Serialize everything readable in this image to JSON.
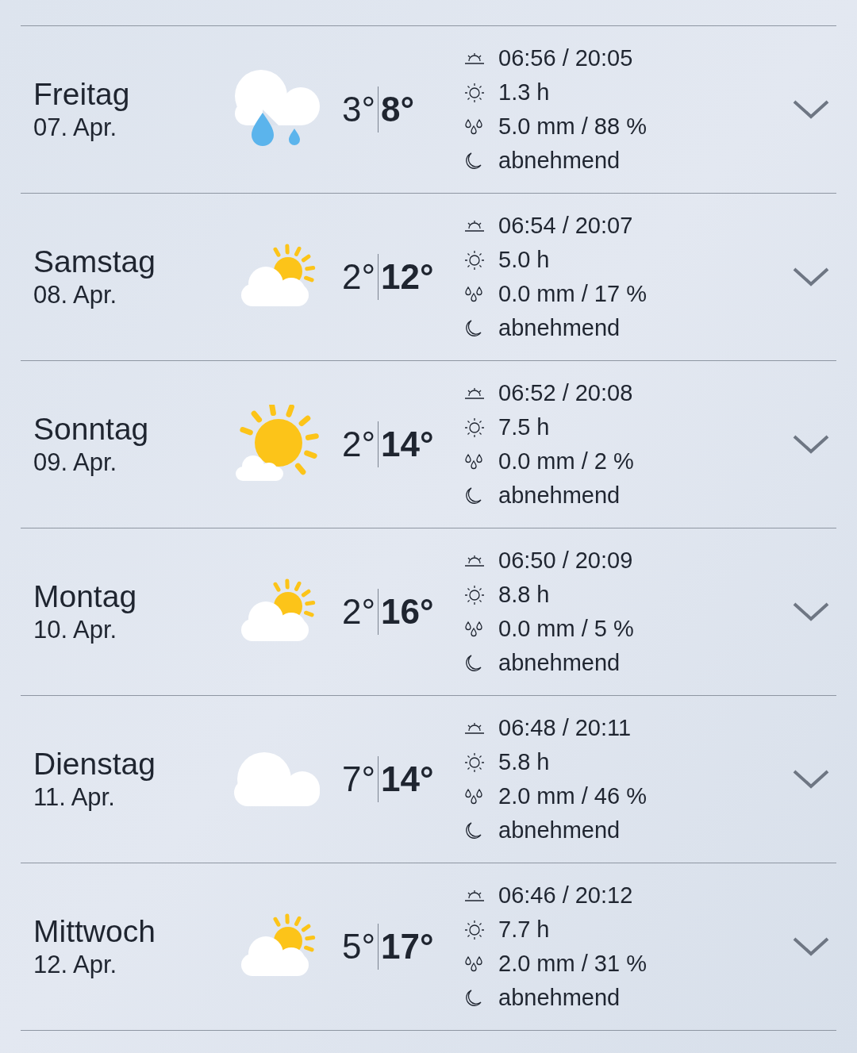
{
  "days": [
    {
      "day": "Freitag",
      "date": "07. Apr.",
      "kind": "rain",
      "low": "3°",
      "high": "8°",
      "sun": "06:56 / 20:05",
      "sunshine": "1.3 h",
      "precip": "5.0 mm / 88 %",
      "moon": "abnehmend"
    },
    {
      "day": "Samstag",
      "date": "08. Apr.",
      "kind": "partly",
      "low": "2°",
      "high": "12°",
      "sun": "06:54 / 20:07",
      "sunshine": "5.0 h",
      "precip": "0.0 mm / 17 %",
      "moon": "abnehmend"
    },
    {
      "day": "Sonntag",
      "date": "09. Apr.",
      "kind": "sunny",
      "low": "2°",
      "high": "14°",
      "sun": "06:52 / 20:08",
      "sunshine": "7.5 h",
      "precip": "0.0 mm / 2 %",
      "moon": "abnehmend"
    },
    {
      "day": "Montag",
      "date": "10. Apr.",
      "kind": "partly",
      "low": "2°",
      "high": "16°",
      "sun": "06:50 / 20:09",
      "sunshine": "8.8 h",
      "precip": "0.0 mm / 5 %",
      "moon": "abnehmend"
    },
    {
      "day": "Dienstag",
      "date": "11. Apr.",
      "kind": "cloudy",
      "low": "7°",
      "high": "14°",
      "sun": "06:48 / 20:11",
      "sunshine": "5.8 h",
      "precip": "2.0 mm / 46 %",
      "moon": "abnehmend"
    },
    {
      "day": "Mittwoch",
      "date": "12. Apr.",
      "kind": "partly",
      "low": "5°",
      "high": "17°",
      "sun": "06:46 / 20:12",
      "sunshine": "7.7 h",
      "precip": "2.0 mm / 31 %",
      "moon": "abnehmend"
    }
  ]
}
